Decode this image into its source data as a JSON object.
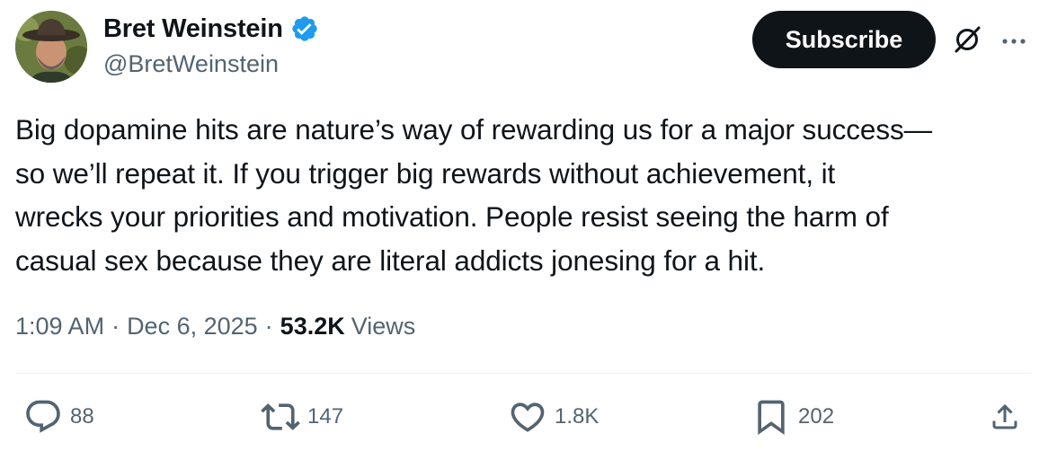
{
  "author": {
    "display_name": "Bret Weinstein",
    "handle": "@BretWeinstein",
    "verified": true
  },
  "header": {
    "subscribe_label": "Subscribe",
    "grok_icon": "grok-icon",
    "more_icon": "more-icon"
  },
  "tweet": {
    "text": "Big dopamine hits are nature’s way of rewarding us for a major success—\nso we’ll repeat it. If you trigger big rewards without achievement, it\nwrecks your priorities and motivation. People resist seeing the harm of\ncasual sex because they are literal addicts jonesing for a hit.",
    "time": "1:09 AM",
    "separator": "·",
    "date": "Dec 6, 2025",
    "views_count": "53.2K",
    "views_label": "Views"
  },
  "actions": {
    "replies": "88",
    "reposts": "147",
    "likes": "1.8K",
    "bookmarks": "202"
  },
  "colors": {
    "text_primary": "#0f1419",
    "text_secondary": "#536471",
    "verified_blue": "#1d9bf0",
    "subscribe_bg": "#0f1419",
    "divider": "#eff3f4"
  }
}
